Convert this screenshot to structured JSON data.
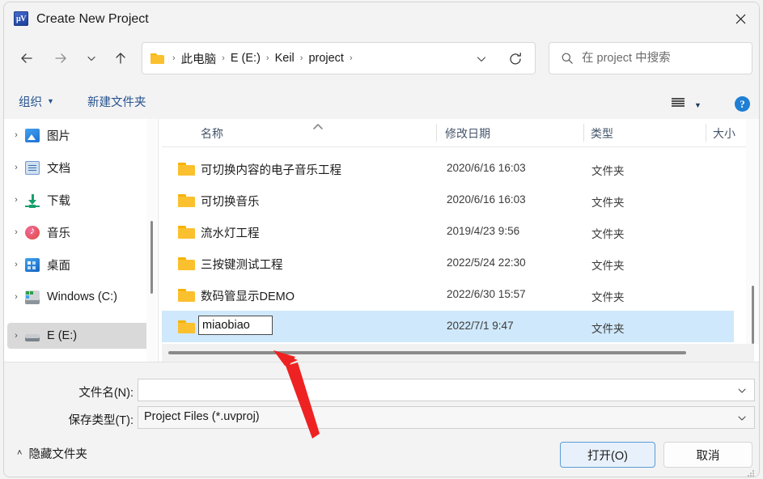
{
  "window": {
    "title": "Create New Project",
    "app_icon": "keil-uvision-icon",
    "close_label": "✕"
  },
  "nav": {
    "back": "back-arrow",
    "forward": "forward-arrow",
    "recent": "chevron-down",
    "up": "up-arrow",
    "breadcrumbs": [
      "此电脑",
      "E (E:)",
      "Keil",
      "project"
    ],
    "breadcrumb_separator": "›",
    "refresh": "refresh-icon",
    "dropdown": "chevron-down"
  },
  "search": {
    "placeholder": "在 project 中搜索",
    "icon": "search-icon"
  },
  "toolbar": {
    "organize": "组织",
    "organize_caret": "▼",
    "new_folder": "新建文件夹",
    "view_icon": "view-list-icon",
    "view_caret": "▼",
    "help": "?"
  },
  "sidebar": {
    "items": [
      {
        "label": "图片",
        "icon": "pictures-icon",
        "chevron": "›",
        "selected": false
      },
      {
        "label": "文档",
        "icon": "documents-icon",
        "chevron": "›",
        "selected": false
      },
      {
        "label": "下载",
        "icon": "downloads-icon",
        "chevron": "›",
        "selected": false
      },
      {
        "label": "音乐",
        "icon": "music-icon",
        "chevron": "›",
        "selected": false
      },
      {
        "label": "桌面",
        "icon": "desktop-icon",
        "chevron": "›",
        "selected": false
      },
      {
        "label": "Windows (C:)",
        "icon": "drive-c-icon",
        "chevron": "›",
        "selected": false
      },
      {
        "label": "E (E:)",
        "icon": "drive-e-icon",
        "chevron": "›",
        "selected": true
      }
    ]
  },
  "filelist": {
    "columns": [
      {
        "label": "名称",
        "sorted": "asc"
      },
      {
        "label": "修改日期",
        "sorted": ""
      },
      {
        "label": "类型",
        "sorted": ""
      },
      {
        "label": "大小",
        "sorted": ""
      }
    ],
    "sort_indicator": "˄",
    "rows": [
      {
        "name": "可切换内容的电子音乐工程",
        "date": "2020/6/16 16:03",
        "type": "文件夹",
        "size": "",
        "selected": false,
        "editing": false
      },
      {
        "name": "可切换音乐",
        "date": "2020/6/16 16:03",
        "type": "文件夹",
        "size": "",
        "selected": false,
        "editing": false
      },
      {
        "name": "流水灯工程",
        "date": "2019/4/23 9:56",
        "type": "文件夹",
        "size": "",
        "selected": false,
        "editing": false
      },
      {
        "name": "三按键测试工程",
        "date": "2022/5/24 22:30",
        "type": "文件夹",
        "size": "",
        "selected": false,
        "editing": false
      },
      {
        "name": "数码管显示DEMO",
        "date": "2022/6/30 15:57",
        "type": "文件夹",
        "size": "",
        "selected": false,
        "editing": false
      },
      {
        "name": "miaobiao",
        "date": "2022/7/1 9:47",
        "type": "文件夹",
        "size": "",
        "selected": true,
        "editing": true
      }
    ]
  },
  "form": {
    "filename_label": "文件名(N):",
    "filename_value": "",
    "filetype_label": "保存类型(T):",
    "filetype_value": "Project Files (*.uvproj)",
    "dropdown_icon": "chevron-down-icon"
  },
  "footer": {
    "hide_folders": "隐藏文件夹",
    "hide_folders_chevron": "˄",
    "open_button": "打开(O)",
    "cancel_button": "取消"
  },
  "annotation": {
    "arrow_color": "#ee2222"
  },
  "colors": {
    "accent": "#1f7fd4",
    "selection": "#cfe8fb",
    "sidebar_selection": "#d9d9d9",
    "folder": "#fbc02d",
    "link_text": "#27548f",
    "header_text": "#44546a"
  }
}
